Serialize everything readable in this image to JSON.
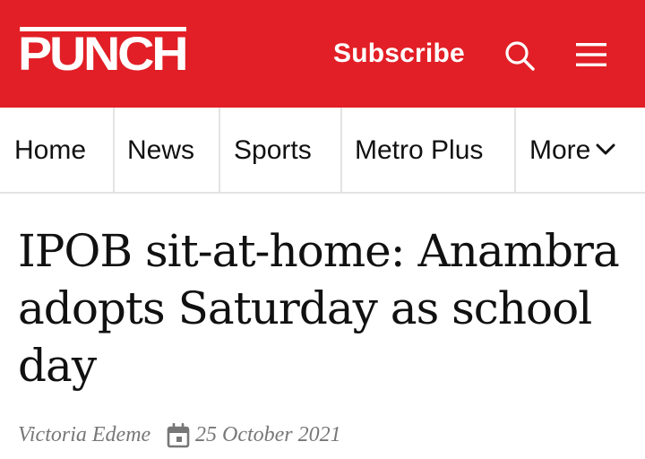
{
  "header": {
    "logo_text": "PUNCH",
    "subscribe_label": "Subscribe",
    "search_icon": "search-icon",
    "menu_icon": "hamburger-menu-icon",
    "brand_color": "#e21f26"
  },
  "nav": {
    "items": [
      {
        "label": "Home"
      },
      {
        "label": "News"
      },
      {
        "label": "Sports"
      },
      {
        "label": "Metro Plus"
      },
      {
        "label": "More"
      }
    ],
    "more_icon": "chevron-down-icon"
  },
  "article": {
    "headline": "IPOB sit-at-home: Anambra adopts Saturday as school day",
    "author": "Victoria Edeme",
    "date_icon": "calendar-icon",
    "date": "25 October 2021"
  }
}
